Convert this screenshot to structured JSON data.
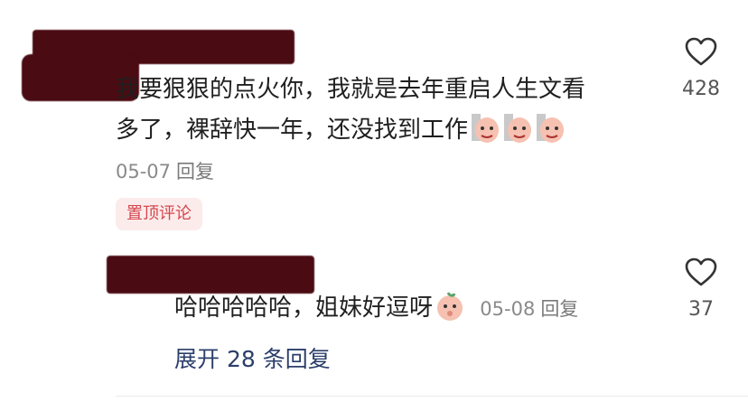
{
  "comment": {
    "line1": "我要狠狠的点火你，我就是去年重启人生文看",
    "line2": "多了，裸辞快一年，还没找到工作",
    "date": "05-07",
    "reply_label": "回复",
    "pinned_badge": "置顶评论",
    "like_count": "428",
    "emoji": [
      "sweat-smile-emoji",
      "sweat-smile-emoji",
      "sweat-smile-emoji"
    ]
  },
  "reply": {
    "text": "哈哈哈哈哈，姐妹好逗呀",
    "emoji": "blush-emoji",
    "date": "05-08",
    "reply_label": "回复",
    "like_count": "37"
  },
  "expand_replies": "展开 28 条回复",
  "colors": {
    "redaction": "#4a0b12",
    "badge_bg": "#fbeceb",
    "badge_text": "#d5464e",
    "link_blue": "#2c3f6a"
  }
}
